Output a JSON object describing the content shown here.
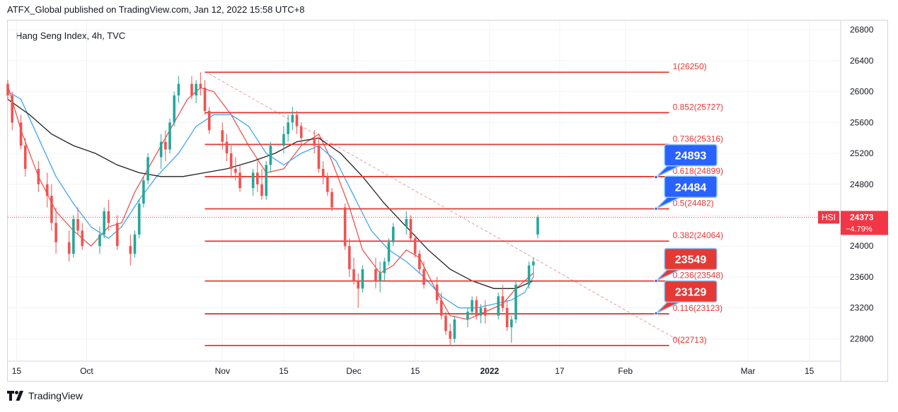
{
  "header": {
    "published": "ATFX_Global published on TradingView.com, Jan 12, 2022 15:58 UTC+8"
  },
  "legend": {
    "symbol_line": "Hang Seng Index, 4h, TVC"
  },
  "brand": {
    "name": "TradingView",
    "logo_icon": "tradingview-logo-icon"
  },
  "colors": {
    "fib_line": "#e53935",
    "fib_text": "#e53935",
    "candle_up": "#26a69a",
    "candle_down": "#ef5350",
    "ma_fast": "#ef5350",
    "ma_mid": "#42a5f5",
    "ma_slow": "#212121",
    "callout_blue": "#2962ff",
    "callout_red": "#e53935",
    "price_tag": "#f23645",
    "grid": "#f0f3fa"
  },
  "chart_data": {
    "type": "candlestick",
    "title": "Hang Seng Index, 4h, TVC",
    "symbol": "HSI",
    "y_axis": {
      "ylim": [
        22520,
        26920
      ],
      "ticks": [
        22800,
        23200,
        23600,
        24000,
        24400,
        24800,
        25200,
        25600,
        26000,
        26400,
        26800
      ],
      "tick_labels": [
        "22800",
        "23200",
        "23600",
        "24000",
        "24400",
        "24800",
        "25200",
        "25600",
        "26000",
        "26400",
        "26800"
      ]
    },
    "x_axis": {
      "range": [
        "2021-09-13",
        "2022-03-22"
      ],
      "ticks": [
        {
          "date": "2021-09-15",
          "label": "15",
          "bold": false
        },
        {
          "date": "2021-10-01",
          "label": "Oct",
          "bold": false
        },
        {
          "date": "2021-11-01",
          "label": "Nov",
          "bold": false
        },
        {
          "date": "2021-11-15",
          "label": "15",
          "bold": false
        },
        {
          "date": "2021-12-01",
          "label": "Dec",
          "bold": false
        },
        {
          "date": "2021-12-15",
          "label": "15",
          "bold": false
        },
        {
          "date": "2022-01-01",
          "label": "2022",
          "bold": true
        },
        {
          "date": "2022-01-17",
          "label": "17",
          "bold": false
        },
        {
          "date": "2022-02-01",
          "label": "Feb",
          "bold": false
        },
        {
          "date": "2022-03-01",
          "label": "Mar",
          "bold": false
        },
        {
          "date": "2022-03-15",
          "label": "15",
          "bold": false
        }
      ]
    },
    "grid": true,
    "last_price": {
      "label": "HSI",
      "value": "24373",
      "change": "−4.79%",
      "price": 24373
    },
    "fibonacci": {
      "start_date": "2021-10-28",
      "end_date": "2022-02-11",
      "levels": [
        {
          "ratio": "1",
          "price": 26250,
          "label": "1(26250)"
        },
        {
          "ratio": "0.852",
          "price": 25727,
          "label": "0.852(25727)"
        },
        {
          "ratio": "0.736",
          "price": 25316,
          "label": "0.736(25316)"
        },
        {
          "ratio": "0.618",
          "price": 24899,
          "label": "0.618(24899)"
        },
        {
          "ratio": "0.5",
          "price": 24482,
          "label": "0.5(24482)"
        },
        {
          "ratio": "0.382",
          "price": 24064,
          "label": "0.382(24064)"
        },
        {
          "ratio": "0.236",
          "price": 23548,
          "label": "0.236(23548)"
        },
        {
          "ratio": "0.116",
          "price": 23123,
          "label": "0.116(23123)"
        },
        {
          "ratio": "0",
          "price": 22713,
          "label": "0(22713)"
        }
      ]
    },
    "trendline": {
      "from": {
        "date": "2021-10-28",
        "price": 26260
      },
      "to": {
        "date": "2022-02-15",
        "price": 22720
      }
    },
    "callouts": [
      {
        "text": "24893",
        "price": 24893,
        "color": "blue"
      },
      {
        "text": "24484",
        "price": 24484,
        "color": "blue"
      },
      {
        "text": "23549",
        "price": 23549,
        "color": "red"
      },
      {
        "text": "23129",
        "price": 23129,
        "color": "red"
      }
    ],
    "anchor_date": "2022-02-08",
    "moving_averages": [
      {
        "color": "ma_fast",
        "points": [
          [
            "2021-09-13",
            26080
          ],
          [
            "2021-09-16",
            25500
          ],
          [
            "2021-09-20",
            24900
          ],
          [
            "2021-09-24",
            24450
          ],
          [
            "2021-09-28",
            24200
          ],
          [
            "2021-10-02",
            24000
          ],
          [
            "2021-10-06",
            24250
          ],
          [
            "2021-10-09",
            24300
          ],
          [
            "2021-10-12",
            24700
          ],
          [
            "2021-10-16",
            25100
          ],
          [
            "2021-10-20",
            25500
          ],
          [
            "2021-10-24",
            25900
          ],
          [
            "2021-10-27",
            26050
          ],
          [
            "2021-10-30",
            26000
          ],
          [
            "2021-11-03",
            25700
          ],
          [
            "2021-11-07",
            25300
          ],
          [
            "2021-11-11",
            24950
          ],
          [
            "2021-11-15",
            25000
          ],
          [
            "2021-11-19",
            25300
          ],
          [
            "2021-11-23",
            25450
          ],
          [
            "2021-11-26",
            25100
          ],
          [
            "2021-11-30",
            24500
          ],
          [
            "2021-12-03",
            23950
          ],
          [
            "2021-12-07",
            23650
          ],
          [
            "2021-12-10",
            23750
          ],
          [
            "2021-12-13",
            23950
          ],
          [
            "2021-12-16",
            23850
          ],
          [
            "2021-12-20",
            23400
          ],
          [
            "2021-12-23",
            23100
          ],
          [
            "2021-12-27",
            23050
          ],
          [
            "2021-12-31",
            23150
          ],
          [
            "2022-01-04",
            23250
          ],
          [
            "2022-01-07",
            23450
          ],
          [
            "2022-01-11",
            23650
          ]
        ]
      },
      {
        "color": "ma_mid",
        "points": [
          [
            "2021-09-13",
            26000
          ],
          [
            "2021-09-16",
            25900
          ],
          [
            "2021-09-20",
            25400
          ],
          [
            "2021-09-24",
            24900
          ],
          [
            "2021-09-28",
            24550
          ],
          [
            "2021-10-02",
            24250
          ],
          [
            "2021-10-06",
            24100
          ],
          [
            "2021-10-09",
            24250
          ],
          [
            "2021-10-13",
            24600
          ],
          [
            "2021-10-17",
            24900
          ],
          [
            "2021-10-22",
            25200
          ],
          [
            "2021-10-26",
            25550
          ],
          [
            "2021-10-30",
            25700
          ],
          [
            "2021-11-03",
            25700
          ],
          [
            "2021-11-07",
            25550
          ],
          [
            "2021-11-11",
            25200
          ],
          [
            "2021-11-15",
            25050
          ],
          [
            "2021-11-19",
            25200
          ],
          [
            "2021-11-23",
            25300
          ],
          [
            "2021-11-27",
            25100
          ],
          [
            "2021-12-01",
            24650
          ],
          [
            "2021-12-05",
            24200
          ],
          [
            "2021-12-09",
            23950
          ],
          [
            "2021-12-13",
            23800
          ],
          [
            "2021-12-17",
            23600
          ],
          [
            "2021-12-21",
            23350
          ],
          [
            "2021-12-25",
            23200
          ],
          [
            "2021-12-29",
            23200
          ],
          [
            "2022-01-02",
            23250
          ],
          [
            "2022-01-06",
            23300
          ],
          [
            "2022-01-09",
            23400
          ],
          [
            "2022-01-11",
            23600
          ]
        ]
      },
      {
        "color": "ma_slow",
        "points": [
          [
            "2021-09-13",
            25900
          ],
          [
            "2021-09-18",
            25700
          ],
          [
            "2021-09-23",
            25450
          ],
          [
            "2021-09-28",
            25300
          ],
          [
            "2021-10-03",
            25200
          ],
          [
            "2021-10-08",
            25050
          ],
          [
            "2021-10-13",
            24950
          ],
          [
            "2021-10-18",
            24900
          ],
          [
            "2021-10-23",
            24900
          ],
          [
            "2021-10-28",
            24950
          ],
          [
            "2021-11-02",
            25000
          ],
          [
            "2021-11-08",
            25100
          ],
          [
            "2021-11-13",
            25200
          ],
          [
            "2021-11-18",
            25350
          ],
          [
            "2021-11-23",
            25400
          ],
          [
            "2021-11-28",
            25200
          ],
          [
            "2021-12-03",
            24900
          ],
          [
            "2021-12-08",
            24550
          ],
          [
            "2021-12-13",
            24250
          ],
          [
            "2021-12-18",
            23950
          ],
          [
            "2021-12-23",
            23700
          ],
          [
            "2021-12-28",
            23550
          ],
          [
            "2022-01-02",
            23450
          ],
          [
            "2022-01-07",
            23450
          ],
          [
            "2022-01-11",
            23550
          ]
        ]
      }
    ],
    "candles": [
      [
        "2021-09-13",
        26100,
        26150,
        25900,
        25950
      ],
      [
        "2021-09-14",
        25950,
        26000,
        25500,
        25600
      ],
      [
        "2021-09-16",
        25600,
        25700,
        25250,
        25300
      ],
      [
        "2021-09-17",
        25300,
        25400,
        24900,
        25000
      ],
      [
        "2021-09-20",
        25000,
        25100,
        24700,
        24800
      ],
      [
        "2021-09-22",
        24800,
        24950,
        24500,
        24650
      ],
      [
        "2021-09-23",
        24650,
        24800,
        24200,
        24300
      ],
      [
        "2021-09-24",
        24300,
        24500,
        23900,
        24050
      ],
      [
        "2021-09-27",
        24050,
        24200,
        23800,
        23900
      ],
      [
        "2021-09-28",
        23900,
        24400,
        23850,
        24350
      ],
      [
        "2021-09-29",
        24350,
        24500,
        24150,
        24200
      ],
      [
        "2021-09-30",
        24200,
        24300,
        23950,
        24000
      ],
      [
        "2021-10-04",
        24000,
        24250,
        23900,
        24150
      ],
      [
        "2021-10-05",
        24150,
        24500,
        24100,
        24450
      ],
      [
        "2021-10-06",
        24450,
        24600,
        24200,
        24300
      ],
      [
        "2021-10-08",
        24300,
        24400,
        23950,
        24000
      ],
      [
        "2021-10-11",
        24000,
        24150,
        23750,
        23900
      ],
      [
        "2021-10-12",
        23900,
        24200,
        23850,
        24150
      ],
      [
        "2021-10-13",
        24150,
        24600,
        24100,
        24550
      ],
      [
        "2021-10-14",
        24550,
        24900,
        24500,
        24850
      ],
      [
        "2021-10-15",
        24850,
        25200,
        24800,
        25150
      ],
      [
        "2021-10-18",
        25150,
        25450,
        25000,
        25350
      ],
      [
        "2021-10-19",
        25350,
        25500,
        25100,
        25250
      ],
      [
        "2021-10-20",
        25250,
        25650,
        25200,
        25600
      ],
      [
        "2021-10-21",
        25600,
        26000,
        25550,
        25950
      ],
      [
        "2021-10-22",
        25950,
        26200,
        25850,
        26100
      ],
      [
        "2021-10-25",
        26100,
        26200,
        25900,
        25950
      ],
      [
        "2021-10-26",
        25950,
        26150,
        25850,
        26100
      ],
      [
        "2021-10-27",
        26100,
        26250,
        25950,
        26050
      ],
      [
        "2021-10-28",
        26050,
        26150,
        25700,
        25750
      ],
      [
        "2021-10-29",
        25750,
        25800,
        25450,
        25500
      ],
      [
        "2021-11-01",
        25500,
        25600,
        25250,
        25350
      ],
      [
        "2021-11-02",
        25350,
        25450,
        25100,
        25200
      ],
      [
        "2021-11-03",
        25200,
        25300,
        24900,
        25000
      ],
      [
        "2021-11-04",
        25000,
        25150,
        24850,
        24950
      ],
      [
        "2021-11-05",
        24950,
        25050,
        24700,
        24750
      ],
      [
        "2021-11-08",
        24750,
        25000,
        24650,
        24950
      ],
      [
        "2021-11-09",
        24950,
        25100,
        24700,
        24800
      ],
      [
        "2021-11-10",
        24800,
        25000,
        24600,
        24650
      ],
      [
        "2021-11-11",
        24650,
        25100,
        24600,
        25050
      ],
      [
        "2021-11-12",
        25050,
        25350,
        24950,
        25300
      ],
      [
        "2021-11-15",
        25300,
        25550,
        25200,
        25450
      ],
      [
        "2021-11-16",
        25450,
        25700,
        25350,
        25600
      ],
      [
        "2021-11-17",
        25600,
        25800,
        25500,
        25700
      ],
      [
        "2021-11-18",
        25700,
        25750,
        25450,
        25550
      ],
      [
        "2021-11-19",
        25550,
        25600,
        25300,
        25400
      ],
      [
        "2021-11-22",
        25400,
        25500,
        25200,
        25300
      ],
      [
        "2021-11-23",
        25300,
        25400,
        24950,
        25000
      ],
      [
        "2021-11-24",
        25000,
        25100,
        24800,
        24900
      ],
      [
        "2021-11-25",
        24900,
        24950,
        24650,
        24700
      ],
      [
        "2021-11-26",
        24700,
        24750,
        24450,
        24500
      ],
      [
        "2021-11-29",
        24500,
        24550,
        23950,
        24000
      ],
      [
        "2021-11-30",
        24000,
        24100,
        23600,
        23700
      ],
      [
        "2021-12-01",
        23700,
        23850,
        23500,
        23550
      ],
      [
        "2021-12-02",
        23550,
        23650,
        23200,
        23450
      ],
      [
        "2021-12-03",
        23450,
        23750,
        23400,
        23700
      ],
      [
        "2021-12-06",
        23700,
        23850,
        23450,
        23550
      ],
      [
        "2021-12-07",
        23550,
        23800,
        23400,
        23650
      ],
      [
        "2021-12-08",
        23650,
        23850,
        23550,
        23800
      ],
      [
        "2021-12-09",
        23800,
        24100,
        23750,
        24050
      ],
      [
        "2021-12-10",
        24050,
        24300,
        24000,
        24250
      ],
      [
        "2021-12-13",
        24250,
        24450,
        24150,
        24350
      ],
      [
        "2021-12-14",
        24350,
        24400,
        24050,
        24100
      ],
      [
        "2021-12-15",
        24100,
        24150,
        23850,
        23900
      ],
      [
        "2021-12-16",
        23900,
        23950,
        23650,
        23700
      ],
      [
        "2021-12-17",
        23700,
        23800,
        23450,
        23500
      ],
      [
        "2021-12-20",
        23500,
        23600,
        23250,
        23300
      ],
      [
        "2021-12-21",
        23300,
        23400,
        23050,
        23100
      ],
      [
        "2021-12-22",
        23100,
        23150,
        22850,
        22900
      ],
      [
        "2021-12-23",
        22900,
        23000,
        22713,
        22800
      ],
      [
        "2021-12-24",
        22800,
        23100,
        22750,
        23050
      ],
      [
        "2021-12-27",
        23050,
        23200,
        22950,
        23150
      ],
      [
        "2021-12-28",
        23150,
        23350,
        23100,
        23300
      ],
      [
        "2021-12-29",
        23300,
        23350,
        23050,
        23100
      ],
      [
        "2021-12-30",
        23100,
        23250,
        23000,
        23200
      ],
      [
        "2021-12-31",
        23200,
        23300,
        23000,
        23100
      ],
      [
        "2022-01-03",
        23100,
        23400,
        23050,
        23350
      ],
      [
        "2022-01-04",
        23350,
        23500,
        23150,
        23200
      ],
      [
        "2022-01-05",
        23200,
        23300,
        22900,
        22950
      ],
      [
        "2022-01-06",
        22950,
        23100,
        22750,
        23050
      ],
      [
        "2022-01-07",
        23050,
        23550,
        23000,
        23500
      ],
      [
        "2022-01-10",
        23500,
        23800,
        23450,
        23750
      ],
      [
        "2022-01-11",
        23750,
        23850,
        23600,
        23800
      ],
      [
        "2022-01-12",
        24150,
        24400,
        24100,
        24373
      ]
    ]
  }
}
